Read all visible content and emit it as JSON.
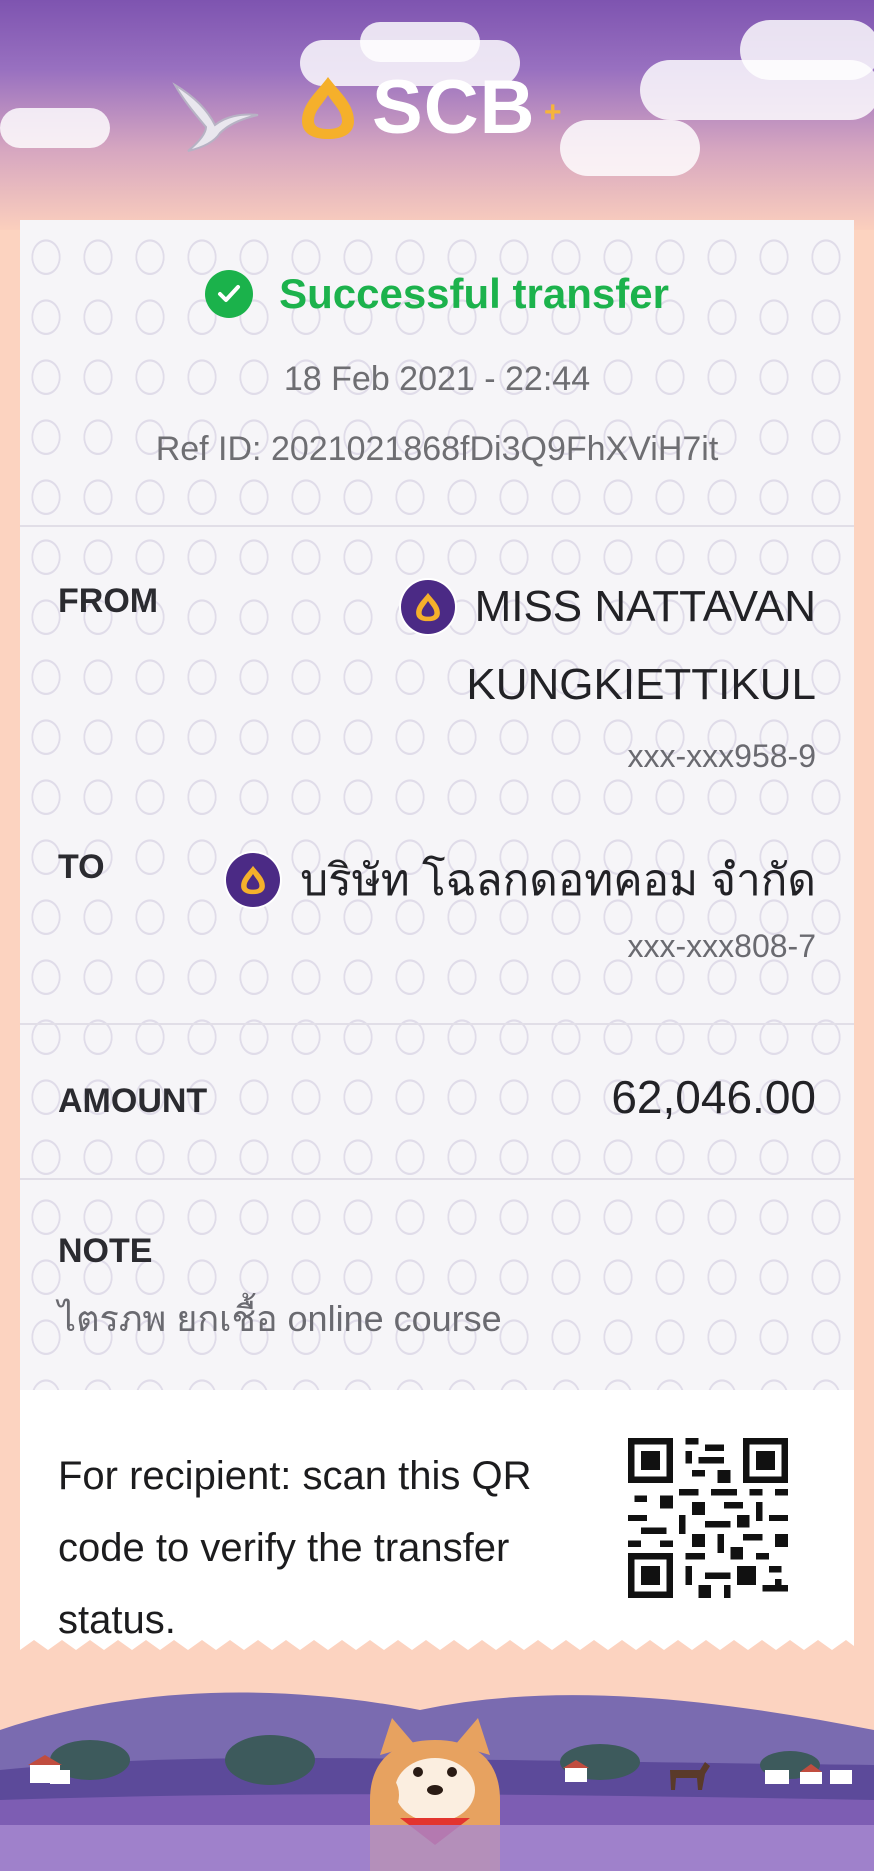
{
  "brand": {
    "logo_text": "SCB",
    "logo_icon": "scb-logo-icon",
    "accent_color": "#7e54b0",
    "success_color": "#1bb24b"
  },
  "receipt": {
    "status": "Successful transfer",
    "status_icon": "check-circle-icon",
    "datetime": "18 Feb 2021 - 22:44",
    "ref_id": "Ref ID: 2021021868fDi3Q9FhXViH7it"
  },
  "from": {
    "label": "FROM",
    "name_line1": "MISS NATTAVAN",
    "name_line2": "KUNGKIETTIKUL",
    "account": "xxx-xxx958-9",
    "bank_icon": "scb-bank-icon"
  },
  "to": {
    "label": "TO",
    "name": "บริษัท โฉลกดอทคอม จำกัด",
    "account": "xxx-xxx808-7",
    "bank_icon": "scb-bank-icon"
  },
  "amount": {
    "label": "AMOUNT",
    "value": "62,046.00"
  },
  "note": {
    "label": "NOTE",
    "value": "ไตรภพ ยกเชื้อ online course"
  },
  "qr": {
    "text": "For recipient: scan this QR code to verify the transfer status.",
    "icon": "qr-code-icon"
  }
}
